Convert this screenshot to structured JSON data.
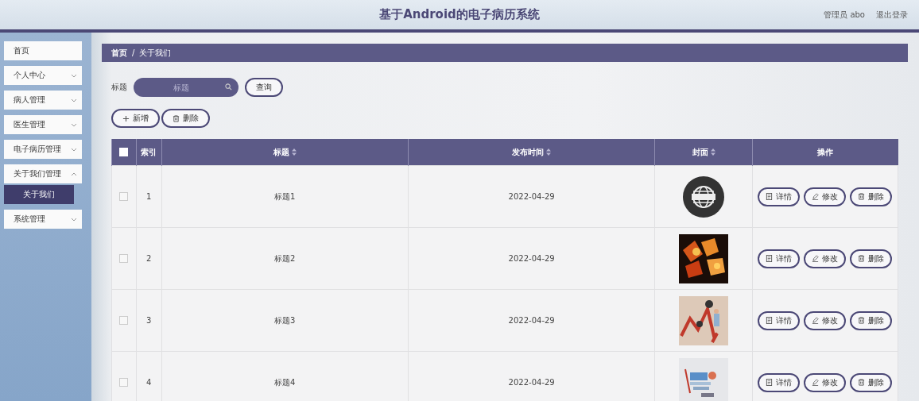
{
  "header": {
    "title": "基于Android的电子病历系统",
    "user": "管理员 abo",
    "logout": "退出登录"
  },
  "sidebar": {
    "items": [
      {
        "label": "首页",
        "kind": "link"
      },
      {
        "label": "个人中心",
        "kind": "menu",
        "expanded": false
      },
      {
        "label": "病人管理",
        "kind": "menu",
        "expanded": false
      },
      {
        "label": "医生管理",
        "kind": "menu",
        "expanded": false
      },
      {
        "label": "电子病历管理",
        "kind": "menu",
        "expanded": false
      },
      {
        "label": "关于我们管理",
        "kind": "menu",
        "expanded": true,
        "children": [
          {
            "label": "关于我们",
            "selected": true
          }
        ]
      },
      {
        "label": "系统管理",
        "kind": "menu",
        "expanded": false
      }
    ]
  },
  "breadcrumb": {
    "items": [
      "首页",
      "关于我们"
    ],
    "separator": "/"
  },
  "search": {
    "label": "标题",
    "placeholder": "标题",
    "button": "查询"
  },
  "toolbar": [
    {
      "kind": "add",
      "label": "新增"
    },
    {
      "kind": "delete",
      "label": "删除"
    }
  ],
  "table": {
    "select_all": {
      "checked": false
    },
    "columns": [
      {
        "label": "索引",
        "sortable": false
      },
      {
        "label": "标题",
        "sortable": true
      },
      {
        "label": "发布时间",
        "sortable": true
      },
      {
        "label": "封面",
        "sortable": true
      },
      {
        "label": "操作",
        "sortable": false
      }
    ],
    "rows": [
      {
        "checked": false,
        "index": "1",
        "title": "标题1",
        "date": "2022-04-29",
        "cover": {
          "kind": "picture"
        },
        "actions": [
          {
            "kind": "detail",
            "label": "详情"
          },
          {
            "kind": "edit",
            "label": "修改"
          },
          {
            "kind": "delete",
            "label": "删除"
          }
        ]
      },
      {
        "checked": false,
        "index": "2",
        "title": "标题2",
        "date": "2022-04-29",
        "cover": {
          "kind": "picture"
        },
        "actions": [
          {
            "kind": "detail",
            "label": "详情"
          },
          {
            "kind": "edit",
            "label": "修改"
          },
          {
            "kind": "delete",
            "label": "删除"
          }
        ]
      },
      {
        "checked": false,
        "index": "3",
        "title": "标题3",
        "date": "2022-04-29",
        "cover": {
          "kind": "picture"
        },
        "actions": [
          {
            "kind": "detail",
            "label": "详情"
          },
          {
            "kind": "edit",
            "label": "修改"
          },
          {
            "kind": "delete",
            "label": "删除"
          }
        ]
      },
      {
        "checked": false,
        "index": "4",
        "title": "标题4",
        "date": "2022-04-29",
        "cover": {
          "kind": "picture"
        },
        "actions": [
          {
            "kind": "detail",
            "label": "详情"
          },
          {
            "kind": "edit",
            "label": "修改"
          },
          {
            "kind": "delete",
            "label": "删除"
          }
        ]
      }
    ]
  }
}
